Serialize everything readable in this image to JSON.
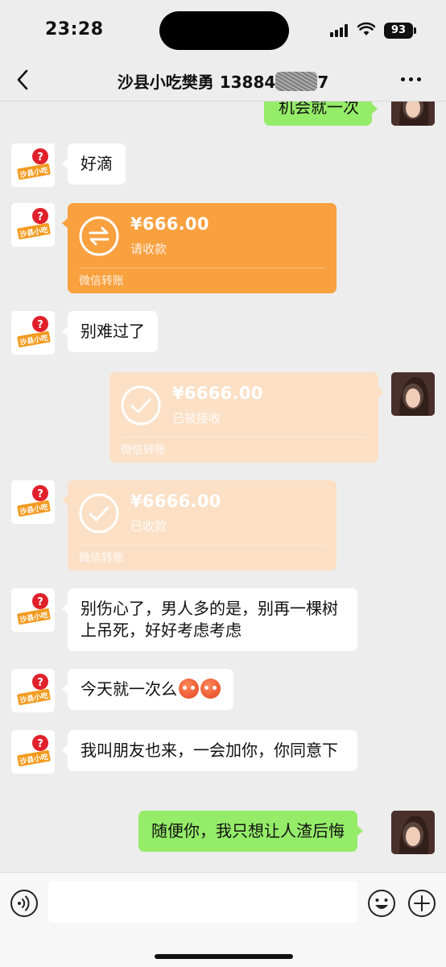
{
  "status_bar": {
    "time": "23:28",
    "battery": "93"
  },
  "nav": {
    "title": "沙县小吃樊勇 13884",
    "title_obscured_suffix": "7"
  },
  "colors": {
    "background": "#ededed",
    "green_bubble": "#95ec69",
    "transfer_pending": "#f9a03f",
    "transfer_done": "#fbe0c6"
  },
  "messages": [
    {
      "id": "m0",
      "side": "right",
      "type": "text",
      "text": "机会就一次"
    },
    {
      "id": "m1",
      "side": "left",
      "type": "text",
      "text": "好滴"
    },
    {
      "id": "m2",
      "side": "left",
      "type": "transfer",
      "status": "pending",
      "amount": "¥666.00",
      "subtext": "请收款",
      "footer": "微信转账",
      "icon": "transfer-arrows-icon"
    },
    {
      "id": "m3",
      "side": "left",
      "type": "text",
      "text": "别难过了"
    },
    {
      "id": "m4",
      "side": "right",
      "type": "transfer",
      "status": "done",
      "amount": "¥6666.00",
      "subtext": "已被接收",
      "footer": "微信转账",
      "icon": "check-icon"
    },
    {
      "id": "m5",
      "side": "left",
      "type": "transfer",
      "status": "done",
      "amount": "¥6666.00",
      "subtext": "已收款",
      "footer": "微信转账",
      "icon": "check-icon"
    },
    {
      "id": "m6",
      "side": "left",
      "type": "text",
      "text": "别伤心了，男人多的是，别再一棵树上吊死，好好考虑考虑"
    },
    {
      "id": "m7",
      "side": "left",
      "type": "text",
      "text": "今天就一次么",
      "emoji": "anxious-face-emoji"
    },
    {
      "id": "m8",
      "side": "left",
      "type": "text",
      "text": "我叫朋友也来，一会加你，你同意下"
    },
    {
      "id": "m9",
      "side": "right",
      "type": "text",
      "text": "随便你，我只想让人渣后悔"
    }
  ],
  "input_bar": {
    "placeholder": "",
    "voice_icon": "voice-icon",
    "emoji_icon": "smiley-icon",
    "plus_icon": "plus-icon"
  }
}
